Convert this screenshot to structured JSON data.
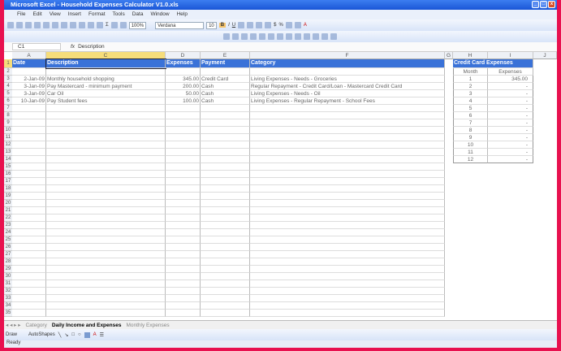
{
  "window": {
    "title": "Microsoft Excel - Household Expenses Calculator V1.0.xls"
  },
  "menu": [
    "File",
    "Edit",
    "View",
    "Insert",
    "Format",
    "Tools",
    "Data",
    "Window",
    "Help"
  ],
  "toolbar": {
    "zoom": "100%",
    "font": "Verdana",
    "font_size": "10"
  },
  "formula_bar": {
    "name_box": "C1",
    "fx_icon": "fx-icon",
    "formula": "Description"
  },
  "columns": [
    "A",
    "C",
    "D",
    "E",
    "F",
    "G",
    "H",
    "I",
    "J"
  ],
  "selected_column": "C",
  "headers": {
    "date": "Date",
    "description": "Description",
    "expenses": "Expenses",
    "payment": "Payment",
    "category": "Category"
  },
  "rows": [
    {
      "row": 3,
      "date": "2-Jan-09",
      "description": "Monthly household shopping",
      "expenses": "345.00",
      "payment": "Credit Card",
      "category": "Living Expenses - Needs - Groceries"
    },
    {
      "row": 4,
      "date": "3-Jan-09",
      "description": "Pay Mastercard - minimum payment",
      "expenses": "200.00",
      "payment": "Cash",
      "category": "Regular Repayment - Credit Card/Loan - Mastercard Credit Card"
    },
    {
      "row": 5,
      "date": "3-Jan-09",
      "description": "Car Oil",
      "expenses": "50.00",
      "payment": "Cash",
      "category": "Living Expenses - Needs - Oil"
    },
    {
      "row": 6,
      "date": "10-Jan-09",
      "description": "Pay Student fees",
      "expenses": "100.00",
      "payment": "Cash",
      "category": "Living Expenses - Regular Repayment - School Fees"
    }
  ],
  "credit_card": {
    "title": "Credit Card Expenses",
    "month_label": "Month",
    "expenses_label": "Expenses",
    "months": [
      {
        "m": "1",
        "v": "345.00"
      },
      {
        "m": "2",
        "v": "-"
      },
      {
        "m": "3",
        "v": "-"
      },
      {
        "m": "4",
        "v": "-"
      },
      {
        "m": "5",
        "v": "-"
      },
      {
        "m": "6",
        "v": "-"
      },
      {
        "m": "7",
        "v": "-"
      },
      {
        "m": "8",
        "v": "-"
      },
      {
        "m": "9",
        "v": "-"
      },
      {
        "m": "10",
        "v": "-"
      },
      {
        "m": "11",
        "v": "-"
      },
      {
        "m": "12",
        "v": "-"
      }
    ]
  },
  "sheet_tabs": [
    {
      "label": "Category",
      "active": false
    },
    {
      "label": "Daily Income and Expenses",
      "active": true
    },
    {
      "label": "Monthly Expenses",
      "active": false
    }
  ],
  "drawing": {
    "draw": "Draw",
    "autoshapes": "AutoShapes"
  },
  "status": "Ready"
}
